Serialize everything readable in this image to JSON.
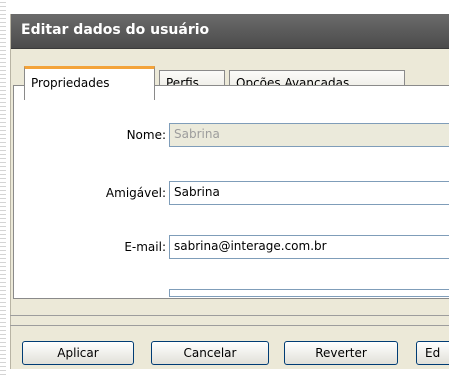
{
  "window": {
    "title": "Editar dados do usuário"
  },
  "tabs": [
    {
      "label": "Propriedades",
      "active": true
    },
    {
      "label": "Perfis",
      "active": false
    },
    {
      "label": "Opções Avançadas",
      "active": false
    }
  ],
  "form": {
    "fields": [
      {
        "label": "Nome:",
        "value": "Sabrina",
        "disabled": true
      },
      {
        "label": "Amigável:",
        "value": "Sabrina",
        "disabled": false
      },
      {
        "label": "E-mail:",
        "value": "sabrina@interage.com.br",
        "disabled": false
      }
    ]
  },
  "buttons": {
    "apply": "Aplicar",
    "cancel": "Cancelar",
    "revert": "Reverter",
    "edit": "Ed"
  }
}
